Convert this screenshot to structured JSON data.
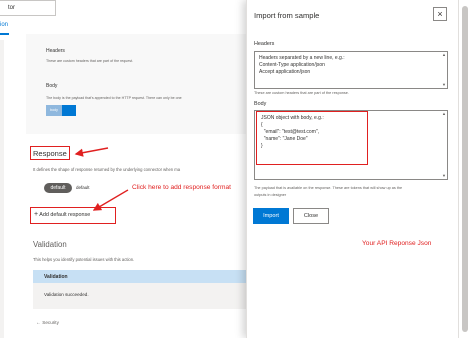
{
  "left": {
    "top_input_value": "tor",
    "tab_label": "ion",
    "headers_label": "Headers",
    "headers_desc": "These are custom headers that are part of the request.",
    "body_label": "Body",
    "body_desc": "The body is the payload that's appended to the HTTP request. There can only be one",
    "body_tag": "body",
    "response_title": "Response",
    "response_desc": "It defines the shape of response returned by the underlying connector when ma",
    "default_chip": "default",
    "default_text": "default",
    "click_note": "Click here to add response format",
    "add_default_label": "Add default response",
    "validation_title": "Validation",
    "validation_desc": "This helps you identify potential issues with this action.",
    "validation_header": "Validation",
    "validation_success": "Validation succeeded.",
    "security_label": "Security"
  },
  "panel": {
    "title": "Import from sample",
    "close_icon": "×",
    "headers_label": "Headers",
    "headers_value": [
      "Headers separated by a new line, e.g.:",
      "Content-Type application/json",
      "Accept application/json"
    ],
    "headers_hint": "These are custom headers that are part of the response.",
    "body_label": "Body",
    "body_value": [
      "JSON object with body, e.g.:",
      "{",
      "  \"email\": \"test@test.com\",",
      "  \"name\": \"Jane Doe\"",
      "}"
    ],
    "body_hint_1": "The payload that is available on the response. These are tokens that will show up as the",
    "body_hint_2": "outputs in designer",
    "import_label": "Import",
    "close_label": "Close",
    "api_note": "Your API Reponse Json"
  },
  "colors": {
    "accent": "#0078d4",
    "annotation_red": "#e02020"
  },
  "icons": {
    "add": "plus-icon",
    "close": "close-icon",
    "security": "chevron-right-icon"
  }
}
